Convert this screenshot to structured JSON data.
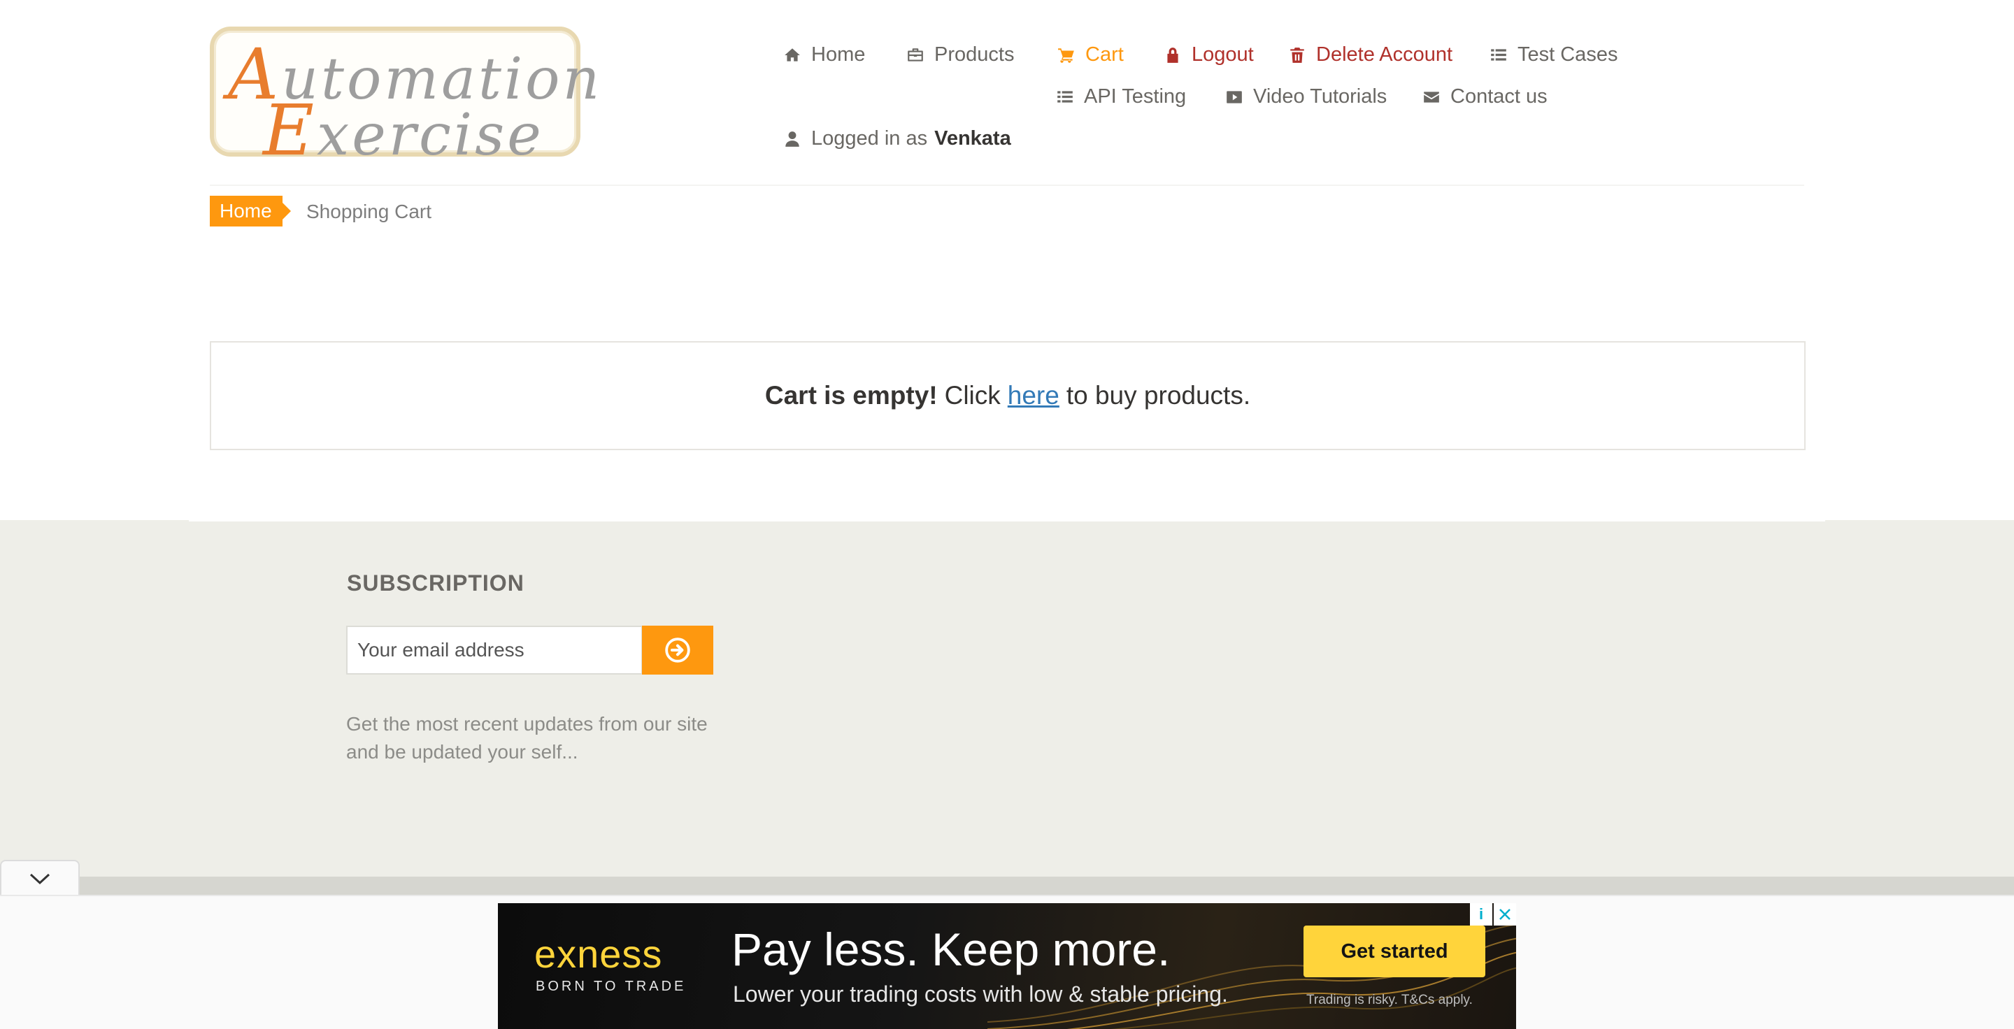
{
  "logo": {
    "line1": "Automation",
    "line2": "Exercise"
  },
  "nav": {
    "home": "Home",
    "products": "Products",
    "cart": "Cart",
    "logout": "Logout",
    "delete_account": "Delete Account",
    "test_cases": "Test Cases",
    "api_testing": "API Testing",
    "video_tutorials": "Video Tutorials",
    "contact_us": "Contact us",
    "logged_in_prefix": "Logged in as",
    "username": "Venkata"
  },
  "breadcrumb": {
    "home": "Home",
    "current": "Shopping Cart"
  },
  "cart": {
    "empty_bold": "Cart is empty!",
    "click_text": "Click",
    "link_text": "here",
    "suffix_text": "to buy products."
  },
  "subscription": {
    "title": "SUBSCRIPTION",
    "email_placeholder": "Your email address",
    "description": "Get the most recent updates from our site and be updated your self..."
  },
  "ad": {
    "brand": "exness",
    "tagline": "BORN TO TRADE",
    "headline": "Pay less. Keep more.",
    "subline": "Lower your trading costs with low & stable pricing.",
    "cta": "Get started",
    "disclaimer": "Trading is risky. T&Cs apply.",
    "info": "i"
  },
  "colors": {
    "accent": "#fe980f",
    "danger": "#b0312b",
    "link": "#337ab7",
    "footer_bg": "#eeeee8",
    "ad_yellow": "#ffd43b"
  },
  "icons": {
    "home": "home-icon",
    "products": "briefcase-icon",
    "cart": "shopping-cart-icon",
    "logout": "lock-icon",
    "delete_account": "trash-icon",
    "test_cases": "list-icon",
    "api_testing": "list-icon",
    "video_tutorials": "youtube-play-icon",
    "contact_us": "envelope-icon",
    "user": "user-icon",
    "subscribe": "arrow-circle-right-icon"
  }
}
